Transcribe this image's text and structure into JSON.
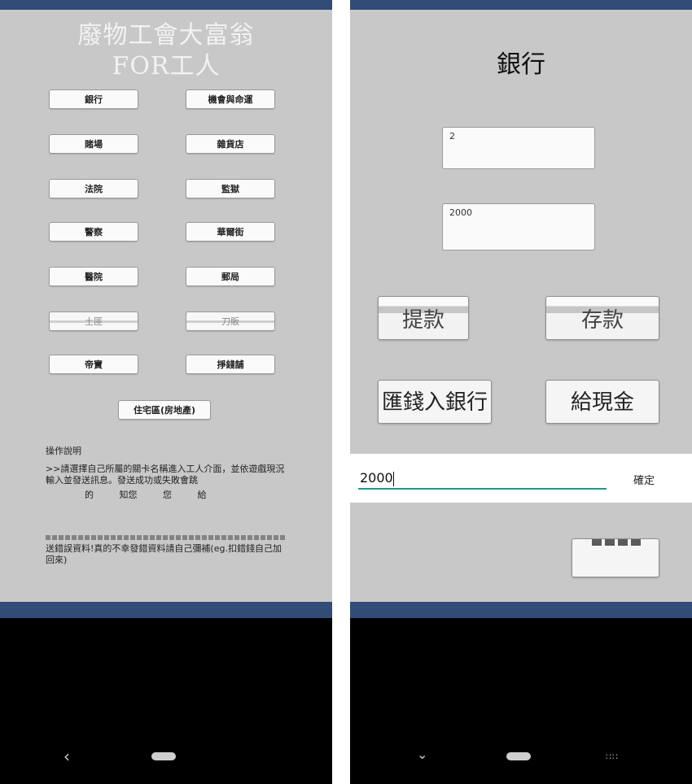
{
  "left_screen": {
    "title_line1": "廢物工會大富翁",
    "title_line2": "FOR工人",
    "menu": [
      {
        "label": "銀行"
      },
      {
        "label": "機會與命運"
      },
      {
        "label": "賭場"
      },
      {
        "label": "雜貨店"
      },
      {
        "label": "法院"
      },
      {
        "label": "監獄"
      },
      {
        "label": "警察"
      },
      {
        "label": "華爾街"
      },
      {
        "label": "醫院"
      },
      {
        "label": "郵局"
      },
      {
        "label": "土匪"
      },
      {
        "label": "刀販"
      },
      {
        "label": "帝寶"
      },
      {
        "label": "掙錢舖"
      }
    ],
    "residential_button": "住宅區(房地產)",
    "help": {
      "title": "操作說明",
      "line1": ">>請選擇自己所屬的關卡名稱進入工人介面，並依遊戲現況輸入並發送訊息。發送成功或失敗會跳",
      "line2": "的 知您 您 給",
      "line3": "送錯誤資料!真的不幸發錯資料請自己彌補(eg.扣錯錢自己加回來)"
    }
  },
  "right_screen": {
    "title": "銀行",
    "count_value": "2",
    "amount_value": "2000",
    "withdraw_label": "提款",
    "deposit_label": "存款",
    "remit_label": "匯錢入銀行",
    "cash_label": "給現金",
    "input_value": "2000",
    "confirm_label": "確定"
  },
  "colors": {
    "status_bar": "#324b77",
    "screen_bg": "#c8c8c8",
    "input_underline": "#1f9a85"
  }
}
